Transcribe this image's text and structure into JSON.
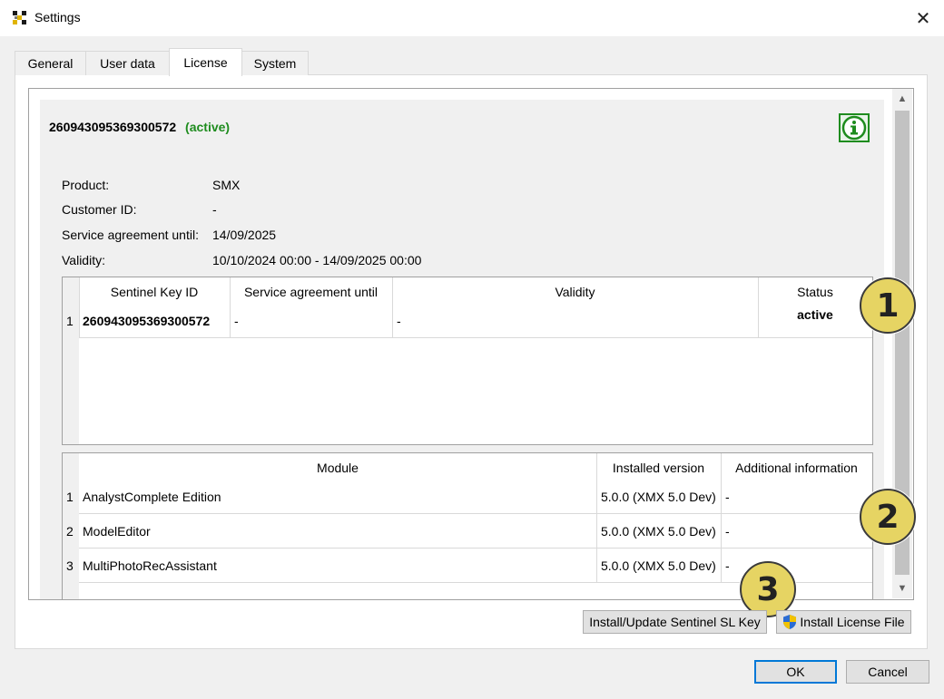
{
  "window": {
    "title": "Settings",
    "close_label": "✕",
    "app_icon": "app-logo-icon"
  },
  "tabs": [
    {
      "label": "General"
    },
    {
      "label": "User data"
    },
    {
      "label": "License"
    },
    {
      "label": "System"
    }
  ],
  "license": {
    "key_id": "260943095369300572",
    "state": "(active)",
    "fields": [
      {
        "label": "Product:",
        "value": "SMX"
      },
      {
        "label": "Customer ID:",
        "value": "-"
      },
      {
        "label": "Service agreement until:",
        "value": "14/09/2025"
      },
      {
        "label": "Validity:",
        "value": "10/10/2024 00:00 - 14/09/2025 00:00"
      }
    ],
    "info_icon": "info-icon"
  },
  "keys_table": {
    "headers": [
      "Sentinel Key ID",
      "Service agreement until",
      "Validity",
      "Status"
    ],
    "rows": [
      {
        "num": "1",
        "key_id": "260943095369300572",
        "service": "-",
        "validity": "-",
        "status": "active"
      }
    ]
  },
  "modules_table": {
    "headers": [
      "Module",
      "Installed version",
      "Additional information"
    ],
    "rows": [
      {
        "num": "1",
        "module": "AnalystComplete Edition",
        "version": "5.0.0 (XMX 5.0 Dev)",
        "info": "-"
      },
      {
        "num": "2",
        "module": "ModelEditor",
        "version": "5.0.0 (XMX 5.0 Dev)",
        "info": "-"
      },
      {
        "num": "3",
        "module": "MultiPhotoRecAssistant",
        "version": "5.0.0 (XMX 5.0 Dev)",
        "info": "-"
      }
    ]
  },
  "markers": [
    "1",
    "2",
    "3"
  ],
  "buttons": {
    "install_sentinel": "Install/Update Sentinel SL Key",
    "install_license_file": "Install License File",
    "ok": "OK",
    "cancel": "Cancel"
  },
  "colors": {
    "active_green": "#1e8c1e",
    "marker_fill": "#e6d463",
    "default_button_border": "#0078d7"
  }
}
